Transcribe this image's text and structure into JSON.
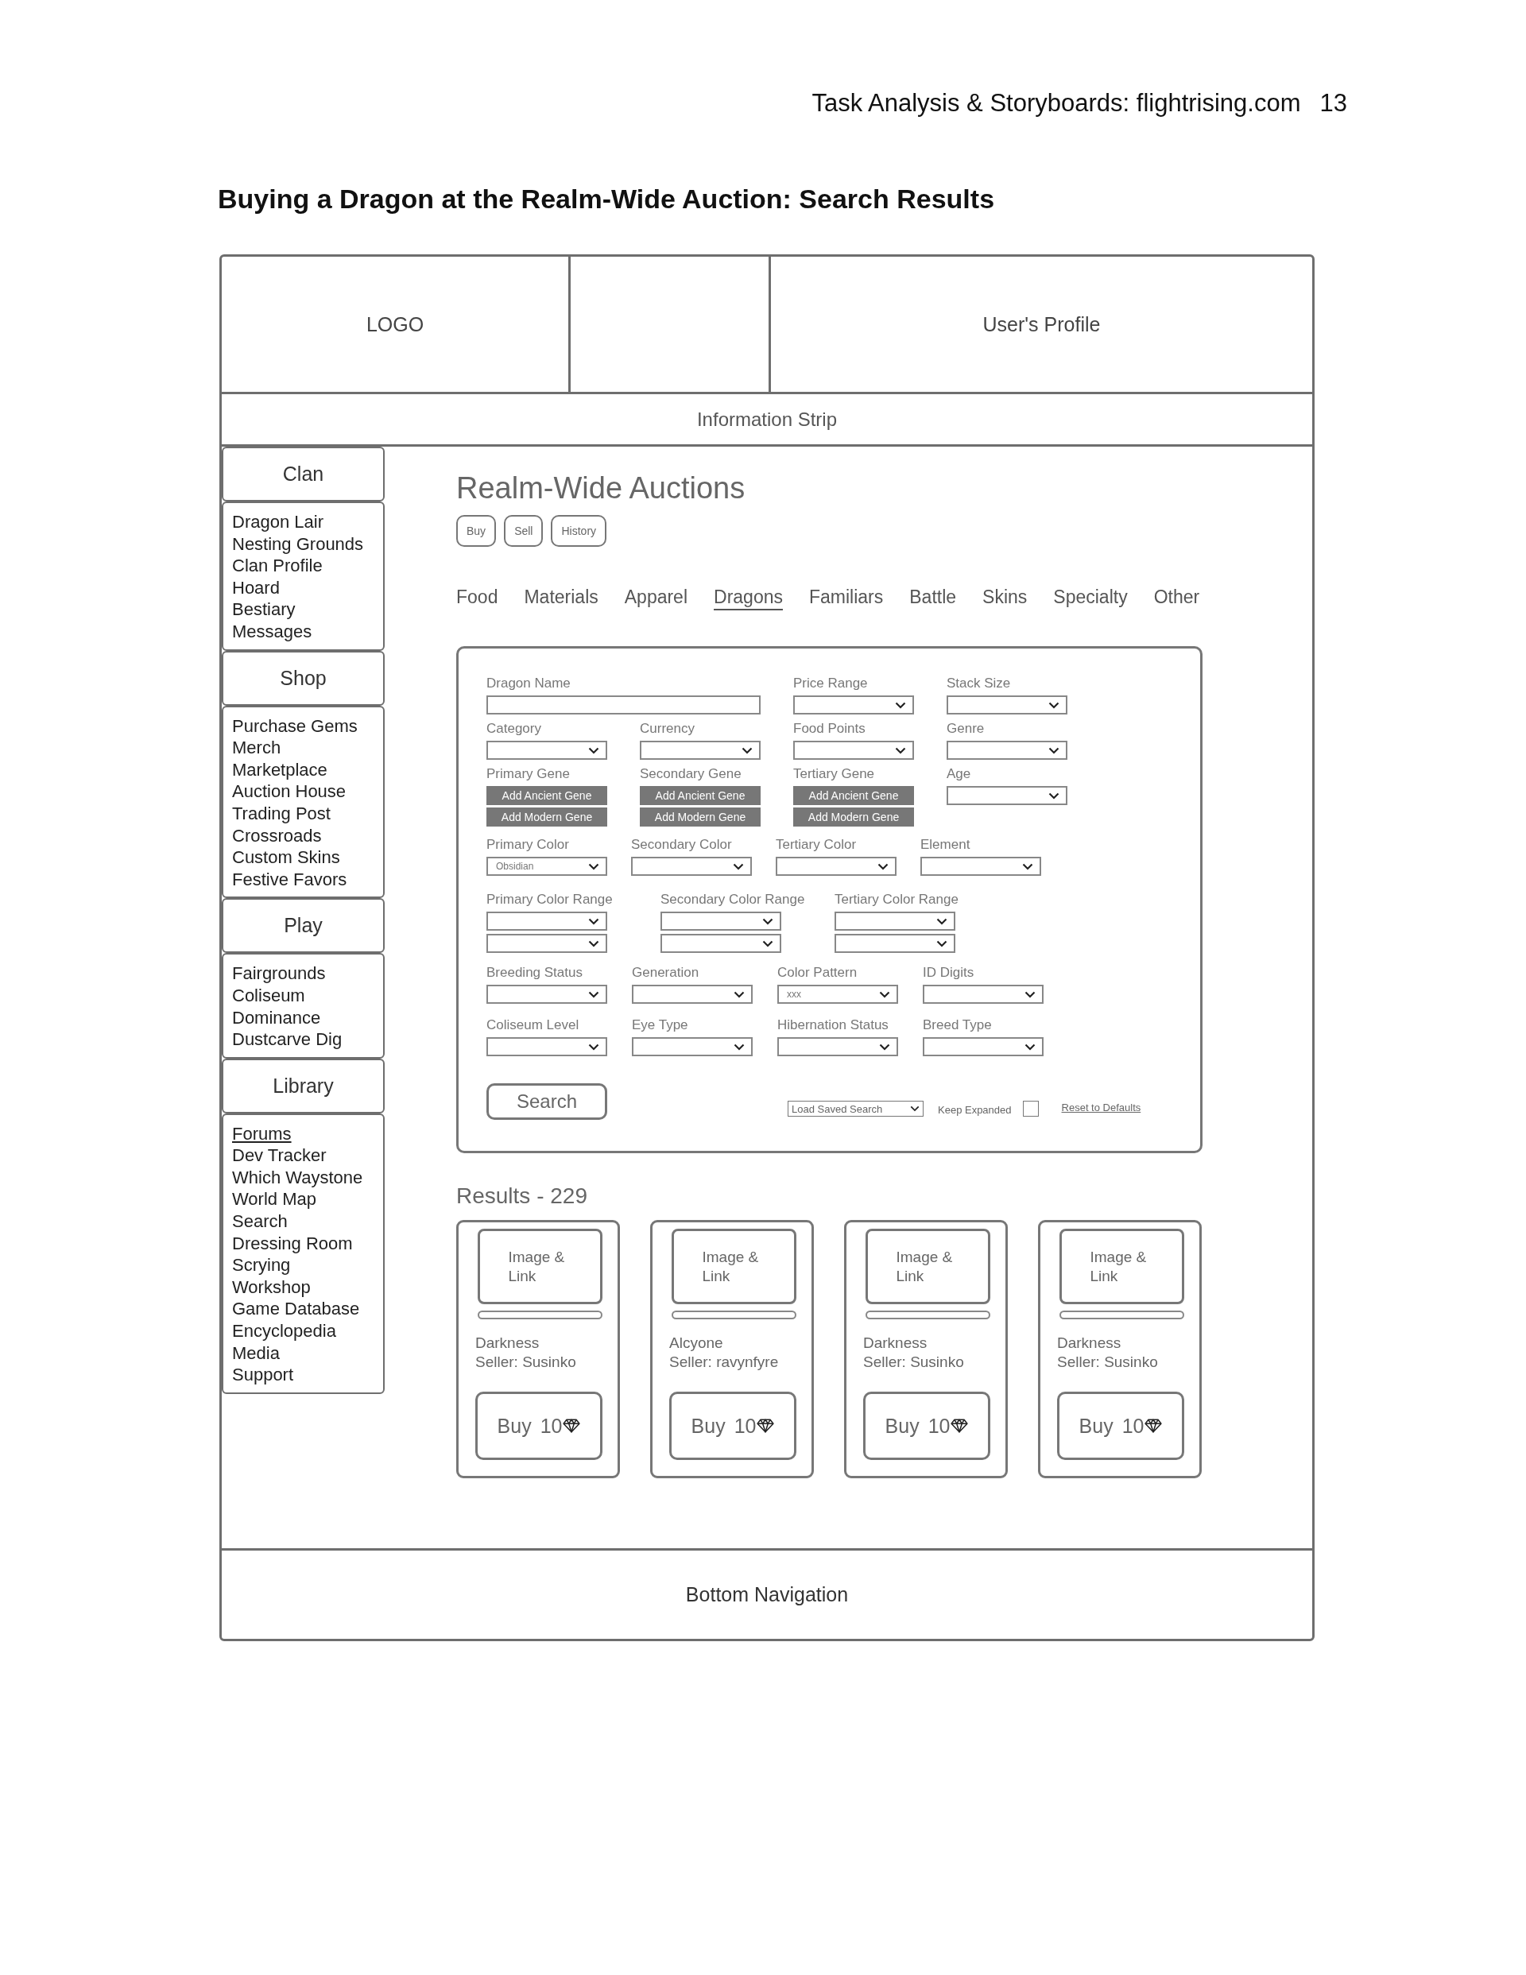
{
  "document": {
    "running_header": "Task Analysis & Storyboards: flightrising.com",
    "page_number": "13",
    "title": "Buying a Dragon at the Realm-Wide Auction: Search Results"
  },
  "header": {
    "logo": "LOGO",
    "profile": "User's Profile"
  },
  "info_strip": "Information Strip",
  "sidebar": [
    {
      "heading": "Clan",
      "items": [
        {
          "label": "Dragon Lair",
          "selected": false
        },
        {
          "label": "Nesting Grounds",
          "selected": false
        },
        {
          "label": "Clan Profile",
          "selected": false
        },
        {
          "label": "Hoard",
          "selected": false
        },
        {
          "label": "Bestiary",
          "selected": false
        },
        {
          "label": "Messages",
          "selected": false
        }
      ]
    },
    {
      "heading": "Shop",
      "items": [
        {
          "label": "Purchase Gems",
          "selected": false
        },
        {
          "label": "Merch",
          "selected": false
        },
        {
          "label": "Marketplace",
          "selected": false
        },
        {
          "label": "Auction House",
          "selected": false
        },
        {
          "label": "Trading Post",
          "selected": false
        },
        {
          "label": "Crossroads",
          "selected": false
        },
        {
          "label": "Custom Skins",
          "selected": false
        },
        {
          "label": "Festive Favors",
          "selected": false
        }
      ]
    },
    {
      "heading": "Play",
      "items": [
        {
          "label": "Fairgrounds",
          "selected": false
        },
        {
          "label": "Coliseum",
          "selected": false
        },
        {
          "label": "Dominance",
          "selected": false
        },
        {
          "label": "Dustcarve Dig",
          "selected": false
        }
      ]
    },
    {
      "heading": "Library",
      "items": [
        {
          "label": "Forums",
          "selected": true
        },
        {
          "label": "Dev Tracker",
          "selected": false
        },
        {
          "label": "Which Waystone",
          "selected": false
        },
        {
          "label": "World Map",
          "selected": false
        },
        {
          "label": "Search",
          "selected": false
        },
        {
          "label": "Dressing Room",
          "selected": false
        },
        {
          "label": "Scrying",
          "selected": false
        },
        {
          "label": "Workshop",
          "selected": false
        },
        {
          "label": "Game Database",
          "selected": false
        },
        {
          "label": "Encyclopedia",
          "selected": false
        },
        {
          "label": "Media",
          "selected": false
        },
        {
          "label": "Support",
          "selected": false
        }
      ]
    }
  ],
  "auctions": {
    "title": "Realm-Wide Auctions",
    "mode_buttons": [
      "Buy",
      "Sell",
      "History"
    ],
    "tabs": [
      {
        "label": "Food",
        "selected": false
      },
      {
        "label": "Materials",
        "selected": false
      },
      {
        "label": "Apparel",
        "selected": false
      },
      {
        "label": "Dragons",
        "selected": true
      },
      {
        "label": "Familiars",
        "selected": false
      },
      {
        "label": "Battle",
        "selected": false
      },
      {
        "label": "Skins",
        "selected": false
      },
      {
        "label": "Specialty",
        "selected": false
      },
      {
        "label": "Other",
        "selected": false
      }
    ]
  },
  "search_form": {
    "rows": [
      {
        "fields": [
          {
            "kind": "text",
            "label": "Dragon Name"
          },
          {
            "kind": "select",
            "label": "Price Range"
          },
          {
            "kind": "select",
            "label": "Stack Size"
          }
        ]
      },
      {
        "fields": [
          {
            "kind": "select",
            "label": "Category"
          },
          {
            "kind": "select",
            "label": "Currency"
          },
          {
            "kind": "select",
            "label": "Food Points"
          },
          {
            "kind": "select",
            "label": "Genre"
          }
        ]
      },
      {
        "fields": [
          {
            "kind": "gene",
            "label": "Primary Gene",
            "buttons": [
              "Add Ancient Gene",
              "Add Modern Gene"
            ]
          },
          {
            "kind": "gene",
            "label": "Secondary Gene",
            "buttons": [
              "Add Ancient Gene",
              "Add Modern Gene"
            ]
          },
          {
            "kind": "gene",
            "label": "Tertiary Gene",
            "buttons": [
              "Add Ancient Gene",
              "Add Modern Gene"
            ]
          },
          {
            "kind": "select",
            "label": "Age"
          }
        ]
      },
      {
        "fields": [
          {
            "kind": "select",
            "label": "Primary Color",
            "value": "Obsidian"
          },
          {
            "kind": "select",
            "label": "Secondary Color"
          },
          {
            "kind": "select",
            "label": "Tertiary Color"
          },
          {
            "kind": "select",
            "label": "Element"
          }
        ]
      },
      {
        "fields": [
          {
            "kind": "range",
            "label": "Primary Color Range"
          },
          {
            "kind": "range",
            "label": "Secondary Color Range"
          },
          {
            "kind": "range",
            "label": "Tertiary Color Range"
          }
        ]
      },
      {
        "fields": [
          {
            "kind": "select",
            "label": "Breeding Status"
          },
          {
            "kind": "select",
            "label": "Generation"
          },
          {
            "kind": "select",
            "label": "Color Pattern",
            "value": "xxx"
          },
          {
            "kind": "select",
            "label": "ID Digits"
          }
        ]
      },
      {
        "fields": [
          {
            "kind": "select",
            "label": "Coliseum Level"
          },
          {
            "kind": "select",
            "label": "Eye Type"
          },
          {
            "kind": "select",
            "label": "Hibernation Status"
          },
          {
            "kind": "select",
            "label": "Breed Type"
          }
        ]
      }
    ],
    "search_button": "Search",
    "saved_search": "Load Saved Search",
    "keep_expanded": {
      "label": "Keep Expanded",
      "checked": false
    },
    "reset_link": "Reset to Defaults"
  },
  "results": {
    "title": "Results - 229",
    "cards": [
      {
        "image_label": "Image & Link",
        "name": "Darkness",
        "seller": "Seller: Susinko",
        "buy_label": "Buy",
        "price": "10"
      },
      {
        "image_label": "Image & Link",
        "name": "Alcyone",
        "seller": "Seller: ravynfyre",
        "buy_label": "Buy",
        "price": "10"
      },
      {
        "image_label": "Image & Link",
        "name": "Darkness",
        "seller": "Seller: Susinko",
        "buy_label": "Buy",
        "price": "10"
      },
      {
        "image_label": "Image & Link",
        "name": "Darkness",
        "seller": "Seller: Susinko",
        "buy_label": "Buy",
        "price": "10"
      }
    ]
  },
  "bottom_nav": "Bottom Navigation"
}
